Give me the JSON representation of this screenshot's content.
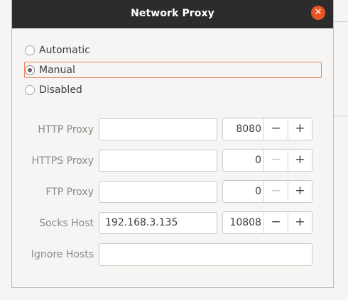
{
  "dialog": {
    "title": "Network Proxy",
    "close_icon": "close-icon",
    "accent": "#e95420"
  },
  "method": {
    "options": [
      {
        "label": "Automatic",
        "selected": false
      },
      {
        "label": "Manual",
        "selected": true
      },
      {
        "label": "Disabled",
        "selected": false
      }
    ]
  },
  "proxies": [
    {
      "label": "HTTP Proxy",
      "host": "",
      "port": "8080",
      "minus_enabled": true
    },
    {
      "label": "HTTPS Proxy",
      "host": "",
      "port": "0",
      "minus_enabled": false
    },
    {
      "label": "FTP Proxy",
      "host": "",
      "port": "0",
      "minus_enabled": false
    },
    {
      "label": "Socks Host",
      "host": "192.168.3.135",
      "port": "10808",
      "minus_enabled": true
    }
  ],
  "ignore_hosts": {
    "label": "Ignore Hosts",
    "value": ""
  },
  "spin_symbols": {
    "minus": "−",
    "plus": "+"
  }
}
